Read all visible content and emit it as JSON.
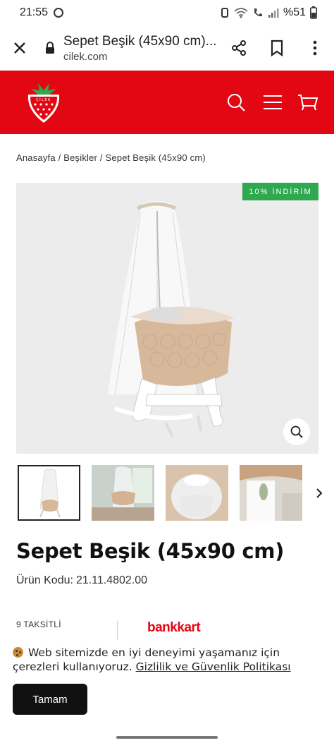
{
  "status_bar": {
    "time": "21:55",
    "battery": "%51"
  },
  "browser": {
    "page_title": "Sepet Beşik (45x90 cm)...",
    "url": "cilek.com"
  },
  "site": {
    "brand_color": "#e30613",
    "logo_text": "ÇİLEK"
  },
  "breadcrumb": "Anasayfa / Beşikler / Sepet Beşik (45x90 cm)",
  "product": {
    "discount_badge": "10% İNDİRİM",
    "title": "Sepet Beşik (45x90 cm)",
    "code_label": "Ürün Kodu:",
    "code_value": "21.11.4802.00",
    "installment_label": "9 TAKSİTLİ",
    "bank_logo": "bankkart",
    "badge_color": "#2fa84f"
  },
  "cookie": {
    "text": "Web sitemizde en iyi deneyimi yaşamanız için çerezleri kullanıyoruz.",
    "link": "Gizlilik ve Güvenlik Politikası",
    "button": "Tamam"
  }
}
